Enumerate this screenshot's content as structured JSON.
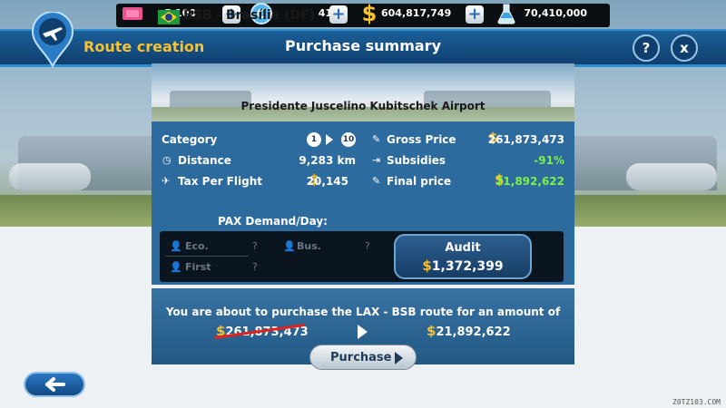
{
  "resources": [
    {
      "icon": "gem-icon",
      "value": "5,100"
    },
    {
      "icon": "coin-c-icon",
      "value": "41"
    },
    {
      "icon": "dollar-icon",
      "value": "604,817,749"
    },
    {
      "icon": "flask-icon",
      "value": "70,410,000"
    }
  ],
  "header": {
    "title": "Route creation",
    "summary": "Purchase summary",
    "help_label": "?",
    "close_label": "x"
  },
  "destination": {
    "title": "BSB - Brasília (DF)",
    "airport": "Presidente Juscelino Kubitschek Airport",
    "flag_country": "Brazil"
  },
  "details": {
    "category_label": "Category",
    "category_from": "1",
    "category_to": "10",
    "distance_label": "Distance",
    "distance_value": "9,283 km",
    "tax_label": "Tax Per Flight",
    "tax_value": "20,145",
    "gross_label": "Gross Price",
    "gross_value": "261,873,473",
    "subsidies_label": "Subsidies",
    "subsidies_value": "-91%",
    "final_label": "Final price",
    "final_value": "21,892,622"
  },
  "pax": {
    "title": "PAX Demand/Day:",
    "eco_label": "Eco.",
    "eco_value": "?",
    "bus_label": "Bus.",
    "bus_value": "?",
    "first_label": "First",
    "first_value": "?"
  },
  "audit": {
    "label": "Audit",
    "value": "1,372,399"
  },
  "purchase": {
    "text": "You are about to purchase the LAX - BSB route for an amount of",
    "old_price": "261,873,473",
    "new_price": "21,892,622",
    "button_label": "Purchase"
  },
  "watermark": "Z0TZ103.COM",
  "colors": {
    "accent_gold": "#f8c12e",
    "panel_blue": "#2d6b9e",
    "header_blue": "#1b5f99",
    "positive_green": "#7cf04b",
    "strike_red": "#e0231b"
  }
}
